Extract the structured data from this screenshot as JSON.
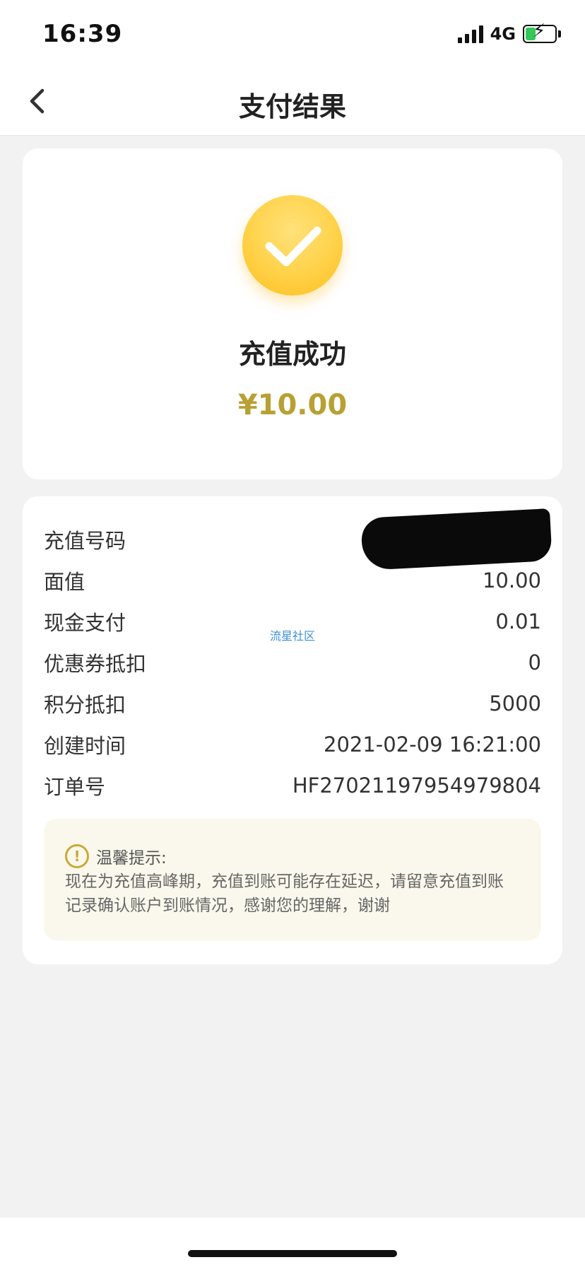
{
  "status_bar": {
    "time": "16:39",
    "network": "4G",
    "icons": [
      "signal-icon",
      "battery-charging-icon"
    ]
  },
  "nav": {
    "title": "支付结果",
    "back_icon": "chevron-left-icon"
  },
  "result": {
    "icon": "checkmark-circle-icon",
    "title": "充值成功",
    "amount": "¥10.00"
  },
  "details": {
    "rows": [
      {
        "label": "充值号码",
        "value": ""
      },
      {
        "label": "面值",
        "value": "10.00"
      },
      {
        "label": "现金支付",
        "value": "0.01"
      },
      {
        "label": "优惠券抵扣",
        "value": "0"
      },
      {
        "label": "积分抵扣",
        "value": "5000"
      },
      {
        "label": "创建时间",
        "value": "2021-02-09 16:21:00"
      },
      {
        "label": "订单号",
        "value": "HF27021197954979804"
      }
    ],
    "watermark": "流星社区"
  },
  "notice": {
    "icon": "exclamation-circle-icon",
    "title": "温馨提示:",
    "text": "现在为充值高峰期，充值到账可能存在延迟，请留意充值到账记录确认账户到账情况，感谢您的理解，谢谢"
  },
  "colors": {
    "accent_gold": "#b8a033",
    "check_yellow": "#ffd148",
    "notice_bg": "#faf8ec"
  }
}
